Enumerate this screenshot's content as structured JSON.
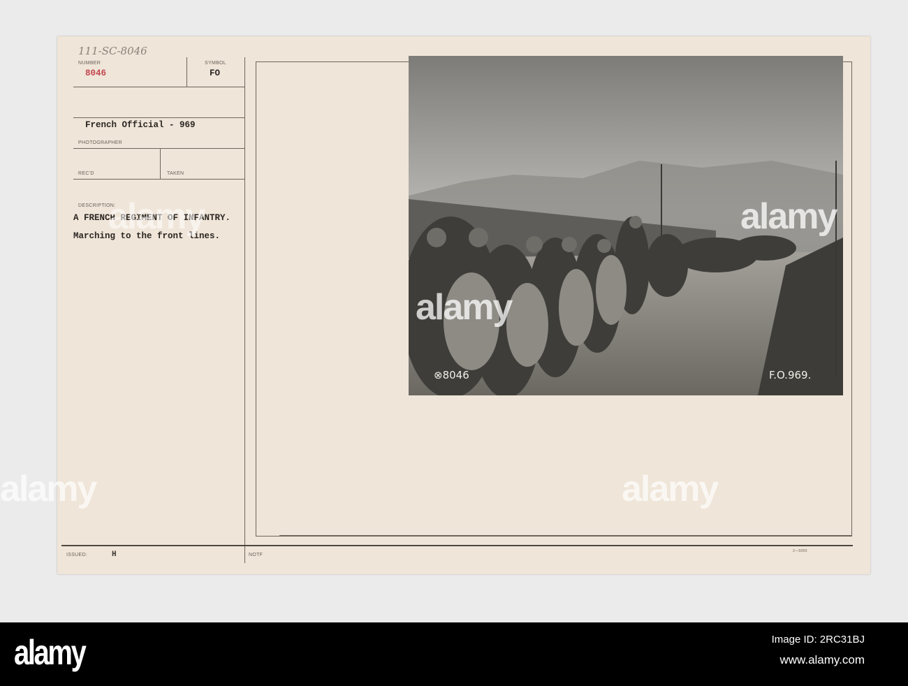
{
  "card": {
    "handwritten_number": "111-SC-8046",
    "number_label": "NUMBER",
    "number_value": "8046",
    "symbol_label": "SYMBOL",
    "symbol_value": "FO",
    "photographer_value": "French Official - 969",
    "photographer_label": "PHOTOGRAPHER",
    "recd_label": "REC'D",
    "taken_label": "TAKEN",
    "description_label": "DESCRIPTION:",
    "description_line1": "A FRENCH REGIMENT OF INFANTRY.",
    "description_line2": "Marching to the front lines.",
    "issued_label": "ISSUED:",
    "issued_value": "H",
    "notf_label": "NOTF",
    "form_number": "2—5000"
  },
  "photo": {
    "caption_left": "⊗8046",
    "caption_right": "F.O.969.",
    "watermark": "alamy",
    "watermark_letter": "a"
  },
  "footer": {
    "logo": "alamy",
    "image_id": "Image ID: 2RC31BJ",
    "url": "www.alamy.com"
  }
}
